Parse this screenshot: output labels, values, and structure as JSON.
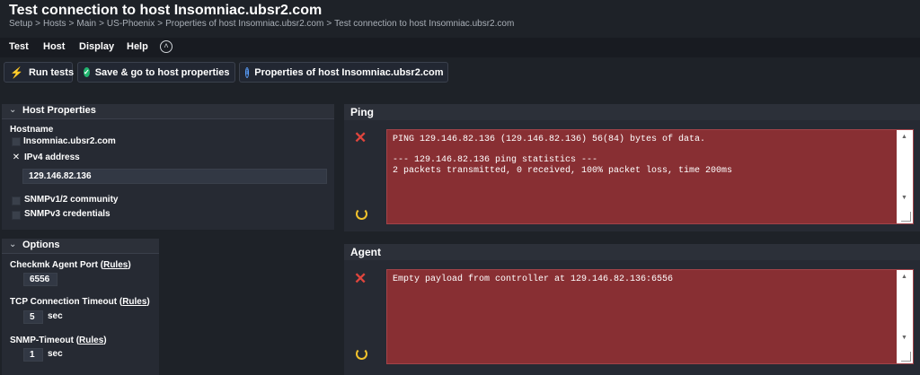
{
  "header": {
    "title": "Test connection to host Insomniac.ubsr2.com",
    "breadcrumb": [
      "Setup",
      "Hosts",
      "Main",
      "US-Phoenix",
      "Properties of host Insomniac.ubsr2.com",
      "Test connection to host Insomniac.ubsr2.com"
    ],
    "breadcrumb_separator": ">"
  },
  "menubar": {
    "items": [
      "Test",
      "Host",
      "Display",
      "Help"
    ],
    "toggle_icon": "chevron-up-circle-icon"
  },
  "toolbar": {
    "run_tests": "Run tests",
    "save_go": "Save & go to host properties",
    "properties": "Properties of host Insomniac.ubsr2.com"
  },
  "host_properties": {
    "title": "Host Properties",
    "hostname_label": "Hostname",
    "hostname_value": "Insomniac.ubsr2.com",
    "ipv4_label": "IPv4 address",
    "ipv4_checked_mark": "✕",
    "ipv4_value": "129.146.82.136",
    "snmp_v12_label": "SNMPv1/2 community",
    "snmp_v3_label": "SNMPv3 credentials"
  },
  "options": {
    "title": "Options",
    "agent_port_label": "Checkmk Agent Port",
    "agent_port_value": "6556",
    "tcp_timeout_label": "TCP Connection Timeout",
    "tcp_timeout_value": "5",
    "snmp_timeout_label": "SNMP-Timeout",
    "snmp_timeout_value": "1",
    "rules_link": "Rules",
    "sec_unit": "sec"
  },
  "ping": {
    "title": "Ping",
    "status_icon": "x-icon",
    "output": "PING 129.146.82.136 (129.146.82.136) 56(84) bytes of data.\n\n--- 129.146.82.136 ping statistics ---\n2 packets transmitted, 0 received, 100% packet loss, time 200ms"
  },
  "agent": {
    "title": "Agent",
    "status_icon": "x-icon",
    "output": "Empty payload from controller at 129.146.82.136:6556"
  },
  "colors": {
    "background": "#1e2228",
    "panel": "#262a33",
    "error_box": "#882f33",
    "error_icon": "#e0453d",
    "reload_icon": "#f2c22c",
    "success_icon": "#21b56f",
    "info_icon": "#5aa0ff"
  }
}
